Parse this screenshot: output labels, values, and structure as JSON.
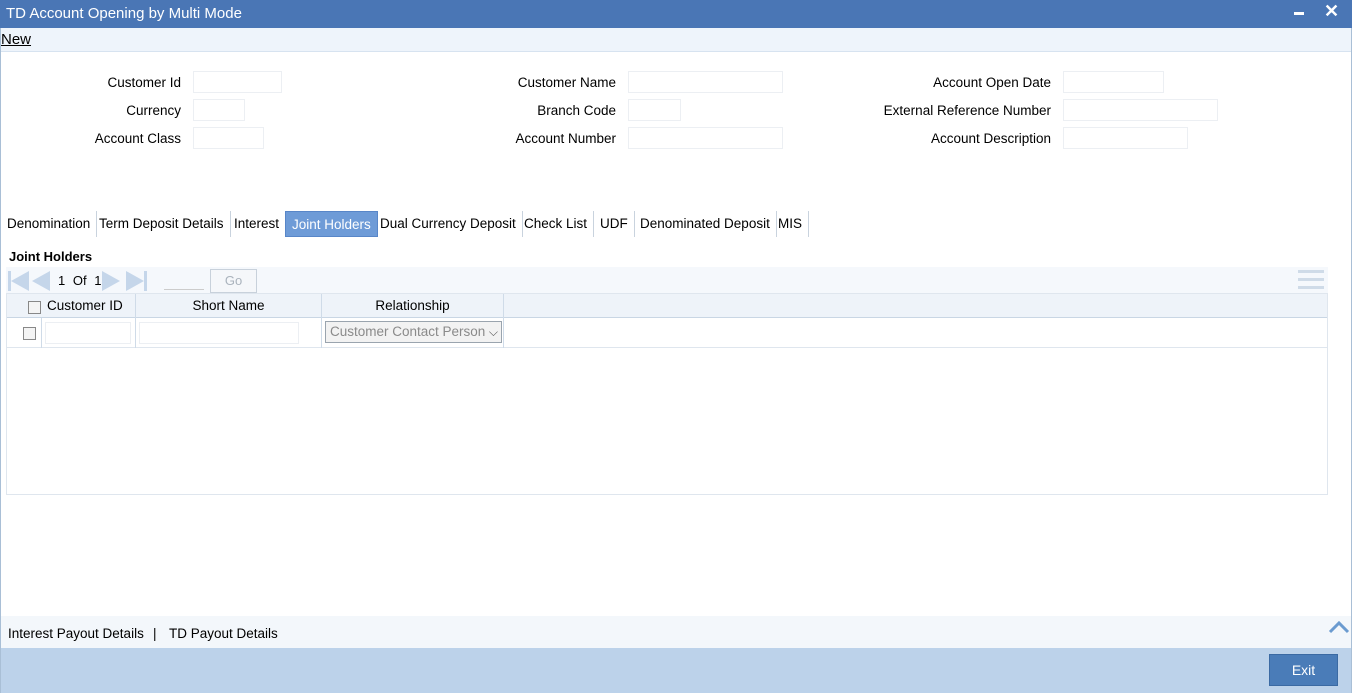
{
  "window": {
    "title": "TD Account Opening by Multi Mode"
  },
  "menu": {
    "new_label": "New"
  },
  "form": {
    "customer_id_label": "Customer Id",
    "currency_label": "Currency",
    "account_class_label": "Account Class",
    "customer_name_label": "Customer Name",
    "branch_code_label": "Branch Code",
    "account_number_label": "Account Number",
    "account_open_date_label": "Account Open Date",
    "external_reference_label": "External Reference Number",
    "account_description_label": "Account Description"
  },
  "tabs": [
    {
      "label": "Denomination"
    },
    {
      "label": "Term Deposit Details"
    },
    {
      "label": "Interest"
    },
    {
      "label": "Joint Holders"
    },
    {
      "label": "Dual Currency Deposit"
    },
    {
      "label": "Check List"
    },
    {
      "label": "UDF"
    },
    {
      "label": "Denominated Deposit"
    },
    {
      "label": "MIS"
    }
  ],
  "active_tab": "Joint Holders",
  "section": {
    "title": "Joint Holders"
  },
  "pager": {
    "current": "1",
    "of_label": "Of",
    "total": "1",
    "go_label": "Go"
  },
  "grid": {
    "headers": {
      "customer_id": "Customer ID",
      "short_name": "Short Name",
      "relationship": "Relationship"
    },
    "rows": [
      {
        "customer_id": "",
        "short_name": "",
        "relationship": "Customer Contact Person"
      }
    ]
  },
  "footer": {
    "interest_payout_label": "Interest Payout Details",
    "separator": "|",
    "td_payout_label": "TD Payout Details"
  },
  "buttons": {
    "exit_label": "Exit"
  },
  "colors": {
    "titlebar": "#4a76b5",
    "active_tab": "#6e9bd7",
    "bottombar": "#bcd2ea",
    "exit_button": "#4a7cb8"
  }
}
